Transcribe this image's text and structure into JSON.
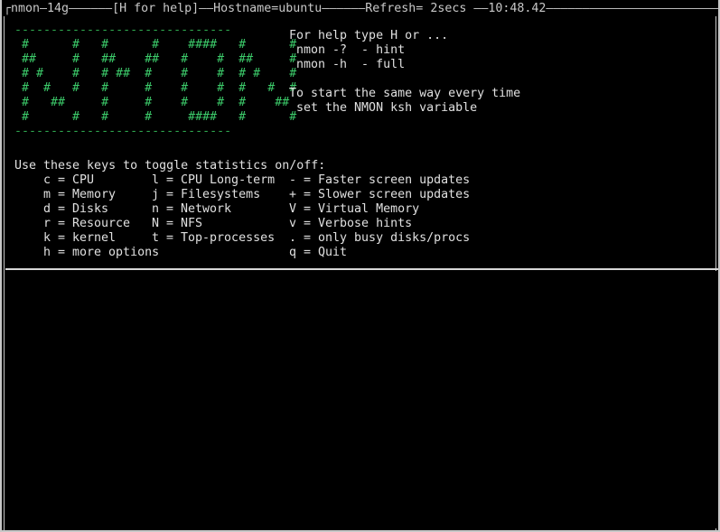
{
  "window": {
    "bg_color": "#000000",
    "fg_color": "#e0e0e0",
    "border_color": "#c8c8c8",
    "accent_green": "#3ccb6a"
  },
  "title_bar": {
    "full_line": "┌nmon—14g——————[H for help]——Hostname=ubuntu——————Refresh= 2secs ——10:48.42—————————————————————————————————————————————————",
    "app_name": "nmon",
    "version": "14g",
    "help_hint": "[H for help]",
    "hostname_label": "Hostname=ubuntu",
    "hostname_value": "ubuntu",
    "refresh_label": "Refresh= 2secs",
    "refresh_value": "2secs",
    "clock": "10:48.42"
  },
  "logo": {
    "color": "#3ccb6a",
    "top_rule": "------------------------------",
    "bottom_rule": "------------------------------",
    "rows": [
      " #      #   #      #    ####   #      #",
      " ##     #   ##    ##   #    #  ##     #",
      " # #    #   # ##  #    #    #  # #    #",
      " #  #   #   #     #    #    #  #   #  #",
      " #   ##     #     #    #    #  #    ##",
      " #      #   #     #     ####   #      #"
    ]
  },
  "intro": {
    "lines": [
      "For help type H or ...",
      " nmon -?  - hint",
      " nmon -h  - full",
      "",
      "To start the same way every time",
      " set the NMON ksh variable"
    ]
  },
  "keys": {
    "heading": "Use these keys to toggle statistics on/off:",
    "column_1": [
      "c = CPU",
      "m = Memory",
      "d = Disks",
      "r = Resource",
      "k = kernel",
      "h = more options"
    ],
    "column_2": [
      "l = CPU Long-term",
      "j = Filesystems",
      "n = Network",
      "N = NFS",
      "t = Top-processes",
      ""
    ],
    "column_3": [
      "- = Faster screen updates",
      "+ = Slower screen updates",
      "V = Virtual Memory",
      "v = Verbose hints",
      ". = only busy disks/procs",
      "q = Quit"
    ]
  }
}
